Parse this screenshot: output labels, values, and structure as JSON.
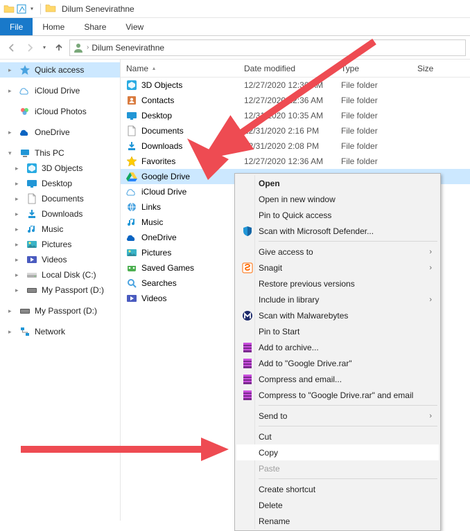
{
  "title": "Dilum Senevirathne",
  "ribbon_tabs": {
    "file": "File",
    "home": "Home",
    "share": "Share",
    "view": "View"
  },
  "breadcrumb": {
    "item": "Dilum Senevirathne"
  },
  "columns": {
    "name": "Name",
    "date": "Date modified",
    "type": "Type",
    "size": "Size"
  },
  "sidebar": {
    "quick_access": "Quick access",
    "icloud_drive": "iCloud Drive",
    "icloud_photos": "iCloud Photos",
    "onedrive": "OneDrive",
    "this_pc": "This PC",
    "pc_children": {
      "objects3d": "3D Objects",
      "desktop": "Desktop",
      "documents": "Documents",
      "downloads": "Downloads",
      "music": "Music",
      "pictures": "Pictures",
      "videos": "Videos",
      "local_disk": "Local Disk (C:)",
      "my_passport": "My Passport (D:)"
    },
    "my_passport2": "My Passport (D:)",
    "network": "Network"
  },
  "files": [
    {
      "name": "3D Objects",
      "date": "12/27/2020 12:36 AM",
      "type": "File folder",
      "icon": "objects3d"
    },
    {
      "name": "Contacts",
      "date": "12/27/2020 12:36 AM",
      "type": "File folder",
      "icon": "contacts"
    },
    {
      "name": "Desktop",
      "date": "12/31/2020 10:35 AM",
      "type": "File folder",
      "icon": "desktop"
    },
    {
      "name": "Documents",
      "date": "12/31/2020 2:16 PM",
      "type": "File folder",
      "icon": "documents"
    },
    {
      "name": "Downloads",
      "date": "12/31/2020 2:08 PM",
      "type": "File folder",
      "icon": "downloads"
    },
    {
      "name": "Favorites",
      "date": "12/27/2020 12:36 AM",
      "type": "File folder",
      "icon": "favorites"
    },
    {
      "name": "Google Drive",
      "date": "",
      "type": "",
      "icon": "gdrive",
      "selected": true
    },
    {
      "name": "iCloud Drive",
      "date": "",
      "type": "",
      "icon": "iclouddrive"
    },
    {
      "name": "Links",
      "date": "",
      "type": "",
      "icon": "links"
    },
    {
      "name": "Music",
      "date": "",
      "type": "",
      "icon": "music"
    },
    {
      "name": "OneDrive",
      "date": "",
      "type": "",
      "icon": "onedrive"
    },
    {
      "name": "Pictures",
      "date": "",
      "type": "",
      "icon": "pictures"
    },
    {
      "name": "Saved Games",
      "date": "",
      "type": "",
      "icon": "savedgames"
    },
    {
      "name": "Searches",
      "date": "",
      "type": "",
      "icon": "searches"
    },
    {
      "name": "Videos",
      "date": "",
      "type": "",
      "icon": "videos"
    }
  ],
  "ctx": {
    "open": "Open",
    "open_new_window": "Open in new window",
    "pin_quick": "Pin to Quick access",
    "scan_defender": "Scan with Microsoft Defender...",
    "give_access": "Give access to",
    "snagit": "Snagit",
    "restore_prev": "Restore previous versions",
    "include_lib": "Include in library",
    "scan_malwarebytes": "Scan with Malwarebytes",
    "pin_start": "Pin to Start",
    "add_archive": "Add to archive...",
    "add_rar": "Add to \"Google Drive.rar\"",
    "compress_email": "Compress and email...",
    "compress_rar_email": "Compress to \"Google Drive.rar\" and email",
    "send_to": "Send to",
    "cut": "Cut",
    "copy": "Copy",
    "paste": "Paste",
    "create_shortcut": "Create shortcut",
    "delete": "Delete",
    "rename": "Rename"
  },
  "colors": {
    "accent": "#1979ca",
    "selection": "#cce8ff",
    "arrow": "#ee4b52"
  }
}
